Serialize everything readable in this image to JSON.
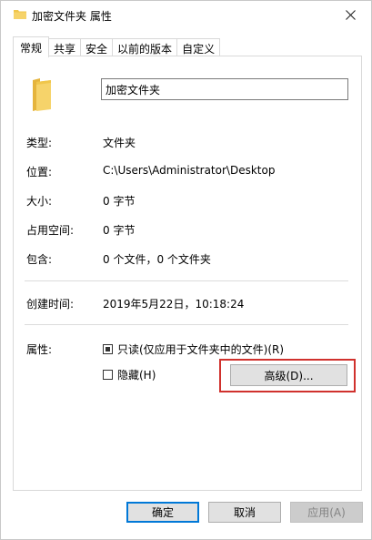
{
  "window": {
    "title": "加密文件夹 属性",
    "close_glyph": "✕"
  },
  "tabs": [
    {
      "label": "常规",
      "active": true
    },
    {
      "label": "共享",
      "active": false
    },
    {
      "label": "安全",
      "active": false
    },
    {
      "label": "以前的版本",
      "active": false
    },
    {
      "label": "自定义",
      "active": false
    }
  ],
  "general": {
    "folder_name": "加密文件夹",
    "rows": {
      "type": {
        "label": "类型:",
        "value": "文件夹"
      },
      "location": {
        "label": "位置:",
        "value": "C:\\Users\\Administrator\\Desktop"
      },
      "size": {
        "label": "大小:",
        "value": "0 字节"
      },
      "size_on_disk": {
        "label": "占用空间:",
        "value": "0 字节"
      },
      "contains": {
        "label": "包含:",
        "value": "0 个文件，0 个文件夹"
      },
      "created": {
        "label": "创建时间:",
        "value": "2019年5月22日，10:18:24"
      }
    },
    "attributes": {
      "label": "属性:",
      "readonly_label": "只读(仅应用于文件夹中的文件)(R)",
      "readonly_state": "indeterminate",
      "hidden_label": "隐藏(H)",
      "hidden_checked": false,
      "advanced_button": "高级(D)..."
    }
  },
  "footer": {
    "ok": "确定",
    "cancel": "取消",
    "apply": "应用(A)"
  },
  "colors": {
    "highlight": "#d0312d",
    "folder": "#f0c64b",
    "accent": "#0078d7"
  },
  "icons": {
    "title": "folder-icon",
    "large": "folder-icon",
    "close": "close-icon"
  }
}
